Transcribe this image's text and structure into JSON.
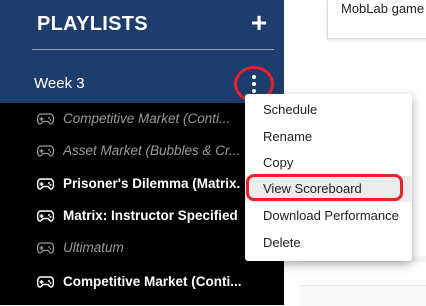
{
  "sidebar": {
    "title": "PLAYLISTS",
    "add_icon": "plus-icon",
    "week": {
      "label": "Week 3",
      "menu_icon": "kebab-vertical-icon"
    },
    "games": [
      {
        "label": "Competitive Market (Conti...",
        "enabled": false
      },
      {
        "label": "Asset Market (Bubbles & Cr...",
        "enabled": false
      },
      {
        "label": "Prisoner's Dilemma (Matrix...",
        "enabled": true
      },
      {
        "label": "Matrix: Instructor Specified",
        "enabled": true
      },
      {
        "label": "Ultimatum",
        "enabled": false
      },
      {
        "label": "Competitive Market (Conti...",
        "enabled": true
      }
    ],
    "game_icon": "gamepad-icon"
  },
  "content": {
    "card_text": "MobLab game"
  },
  "menu": {
    "items": [
      {
        "label": "Schedule"
      },
      {
        "label": "Rename"
      },
      {
        "label": "Copy"
      },
      {
        "label": "View Scoreboard",
        "highlighted": true
      },
      {
        "label": "Download Performance"
      },
      {
        "label": "Delete"
      }
    ]
  },
  "colors": {
    "sidebar_header": "#1f3d6c",
    "sidebar_body": "#000000",
    "annotation_red": "#e8232e"
  }
}
